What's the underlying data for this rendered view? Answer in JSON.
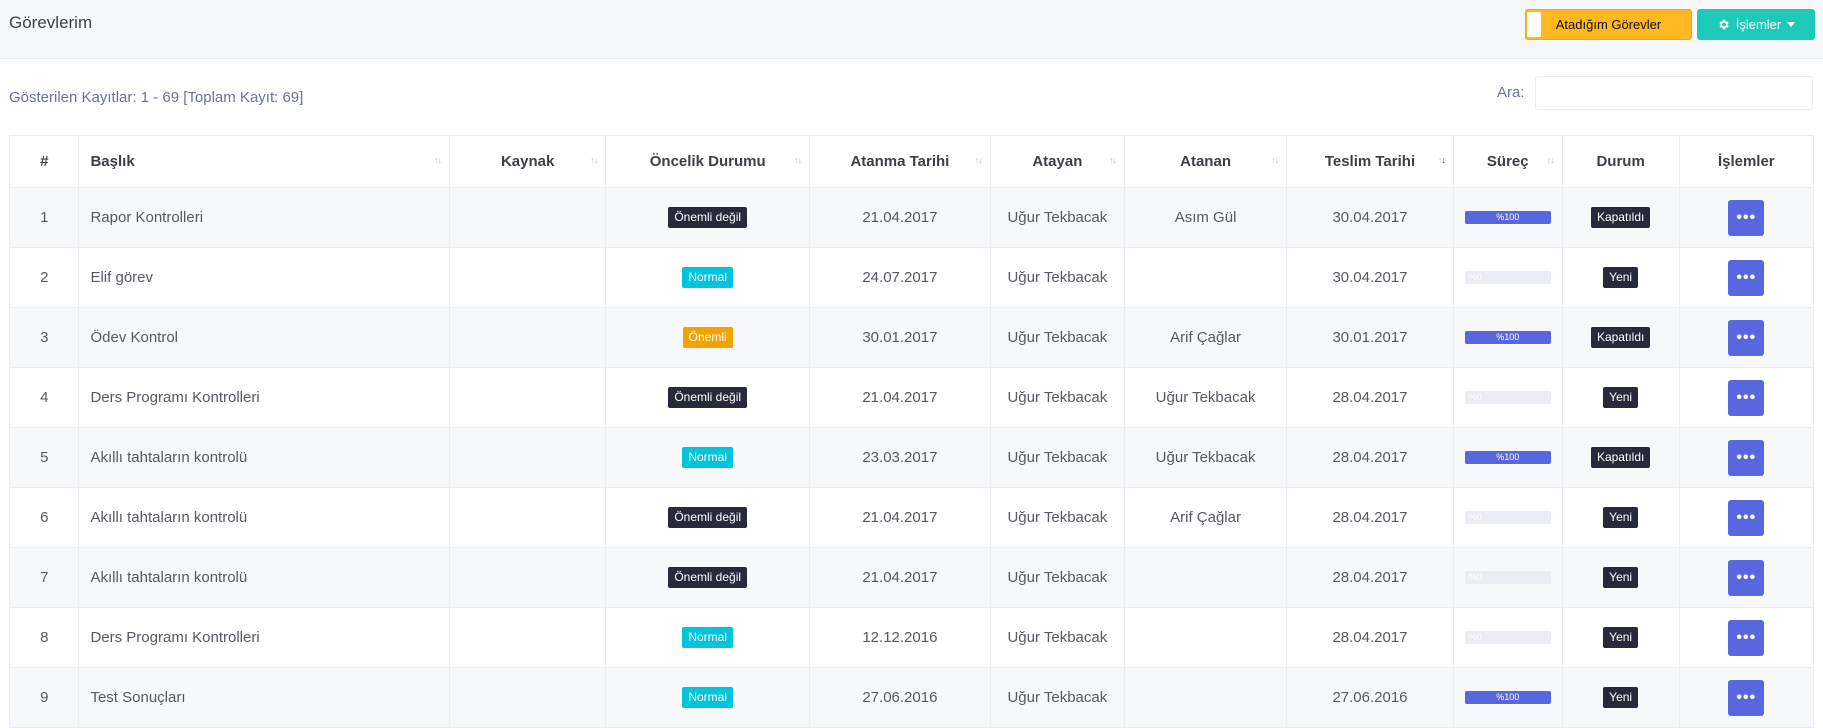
{
  "header": {
    "title": "Görevlerim",
    "assigned_button": "Atadığım Görevler",
    "actions_button": "İşlemler",
    "actions_icon": "gear-icon"
  },
  "records_info": "Gösterilen Kayıtlar: 1 - 69 [Toplam Kayıt: 69]",
  "search": {
    "label": "Ara:",
    "value": ""
  },
  "columns": [
    "#",
    "Başlık",
    "Kaynak",
    "Öncelik Durumu",
    "Atanma Tarihi",
    "Atayan",
    "Atanan",
    "Teslim Tarihi",
    "Süreç",
    "Durum",
    "İşlemler"
  ],
  "rows": [
    {
      "no": "1",
      "title": "Rapor Kontrolleri",
      "source": "",
      "priority": "Önemli değil",
      "assigned_date": "21.04.2017",
      "assigner": "Uğur Tekbacak",
      "assignee": "Asım Gül",
      "due_date": "30.04.2017",
      "progress": 100,
      "progress_label": "%100",
      "status": "Kapatıldı"
    },
    {
      "no": "2",
      "title": "Elif görev",
      "source": "",
      "priority": "Normal",
      "assigned_date": "24.07.2017",
      "assigner": "Uğur Tekbacak",
      "assignee": "",
      "due_date": "30.04.2017",
      "progress": 0,
      "progress_label": "%0",
      "status": "Yeni"
    },
    {
      "no": "3",
      "title": "Ödev Kontrol",
      "source": "",
      "priority": "Önemli",
      "assigned_date": "30.01.2017",
      "assigner": "Uğur Tekbacak",
      "assignee": "Arif Çağlar",
      "due_date": "30.01.2017",
      "progress": 100,
      "progress_label": "%100",
      "status": "Kapatıldı"
    },
    {
      "no": "4",
      "title": "Ders Programı Kontrolleri",
      "source": "",
      "priority": "Önemli değil",
      "assigned_date": "21.04.2017",
      "assigner": "Uğur Tekbacak",
      "assignee": "Uğur Tekbacak",
      "due_date": "28.04.2017",
      "progress": 0,
      "progress_label": "%0",
      "status": "Yeni"
    },
    {
      "no": "5",
      "title": "Akıllı tahtaların kontrolü",
      "source": "",
      "priority": "Normal",
      "assigned_date": "23.03.2017",
      "assigner": "Uğur Tekbacak",
      "assignee": "Uğur Tekbacak",
      "due_date": "28.04.2017",
      "progress": 100,
      "progress_label": "%100",
      "status": "Kapatıldı"
    },
    {
      "no": "6",
      "title": "Akıllı tahtaların kontrolü",
      "source": "",
      "priority": "Önemli değil",
      "assigned_date": "21.04.2017",
      "assigner": "Uğur Tekbacak",
      "assignee": "Arif Çağlar",
      "due_date": "28.04.2017",
      "progress": 0,
      "progress_label": "%0",
      "status": "Yeni"
    },
    {
      "no": "7",
      "title": "Akıllı tahtaların kontrolü",
      "source": "",
      "priority": "Önemli değil",
      "assigned_date": "21.04.2017",
      "assigner": "Uğur Tekbacak",
      "assignee": "",
      "due_date": "28.04.2017",
      "progress": 0,
      "progress_label": "%0",
      "status": "Yeni"
    },
    {
      "no": "8",
      "title": "Ders Programı Kontrolleri",
      "source": "",
      "priority": "Normal",
      "assigned_date": "12.12.2016",
      "assigner": "Uğur Tekbacak",
      "assignee": "",
      "due_date": "28.04.2017",
      "progress": 0,
      "progress_label": "%0",
      "status": "Yeni"
    },
    {
      "no": "9",
      "title": "Test Sonuçları",
      "source": "",
      "priority": "Normal",
      "assigned_date": "27.06.2016",
      "assigner": "Uğur Tekbacak",
      "assignee": "",
      "due_date": "27.06.2016",
      "progress": 100,
      "progress_label": "%100",
      "status": "Yeni"
    }
  ],
  "row_action_icon": "ellipsis-icon",
  "colors": {
    "accent": "#5867dd",
    "priority_low": "#282a3c",
    "priority_normal": "#00c5dc",
    "priority_high": "#f4a200",
    "warning_button": "#ffb822",
    "actions_button": "#1dc9b7"
  }
}
